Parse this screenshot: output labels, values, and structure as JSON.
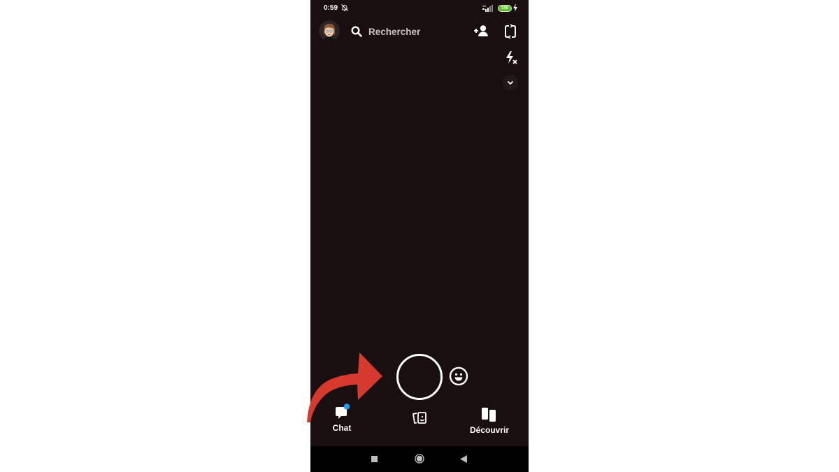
{
  "status_bar": {
    "time": "0:59",
    "notifications": "bell-off-icon",
    "network_label": "4G",
    "battery_level": "100",
    "charging": true
  },
  "top_bar": {
    "avatar": "bitmoji-avatar",
    "search_placeholder": "Rechercher",
    "add_friend_icon": "add-friend-icon",
    "flip_camera_icon": "flip-camera-icon"
  },
  "side_tools": {
    "flash_icon": "flash-off-icon",
    "more_icon": "chevron-down-icon"
  },
  "capture": {
    "shutter": "capture-button",
    "lenses_icon": "smiley-lens-icon"
  },
  "bottom_nav": {
    "items": [
      {
        "label": "Chat",
        "icon": "chat-icon",
        "badge": true
      },
      {
        "label": "",
        "icon": "stories-icon"
      },
      {
        "label": "Découvrir",
        "icon": "discover-icon"
      }
    ]
  },
  "system_nav": {
    "recent": "square-icon",
    "home": "circle-icon",
    "back": "triangle-back-icon"
  },
  "annotation": {
    "type": "red-curved-arrow",
    "color": "#d63a2f",
    "points_to": "capture-button"
  },
  "colors": {
    "camera_background": "#1a0f10",
    "badge": "#1e9bf0",
    "battery": "#5bbf2a"
  }
}
